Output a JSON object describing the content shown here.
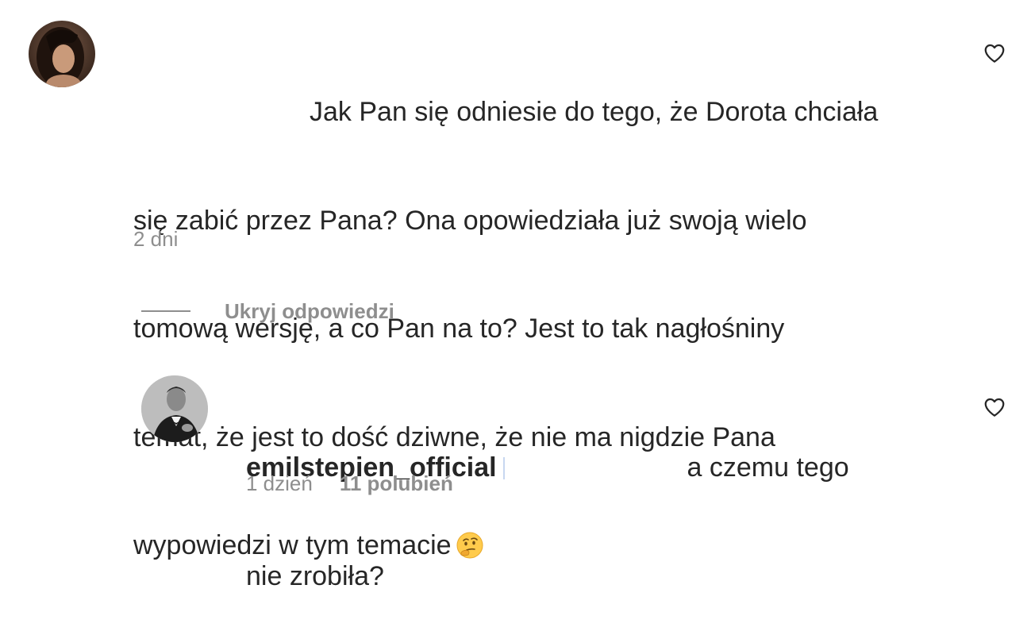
{
  "comment": {
    "text_line1": "Jak Pan się odniesie do tego, że Dorota chciała",
    "text_line2": "się zabić przez Pana? Ona opowiedziała już swoją wielo",
    "text_line3": "tomową wersję, a co Pan na to? Jest to tak nagłośniny",
    "text_line4": "temat, że jest to dość dziwne, że nie ma nigdzie Pana",
    "text_line5": "wypowiedzi w tym temacie",
    "emoji": "thinking-face-icon",
    "time": "2 dni",
    "like_icon": "heart-outline-icon"
  },
  "replies_toggle": {
    "label": "Ukryj odpowiedzi"
  },
  "reply": {
    "username": "emilstepien_official",
    "text_line1": "a czemu tego",
    "text_line2": "nie zrobiła?",
    "time": "1 dzień",
    "likes": "11 polubień",
    "like_icon": "heart-outline-icon"
  },
  "colors": {
    "text_primary": "#262626",
    "text_secondary": "#8e8e8e",
    "background": "#ffffff"
  }
}
